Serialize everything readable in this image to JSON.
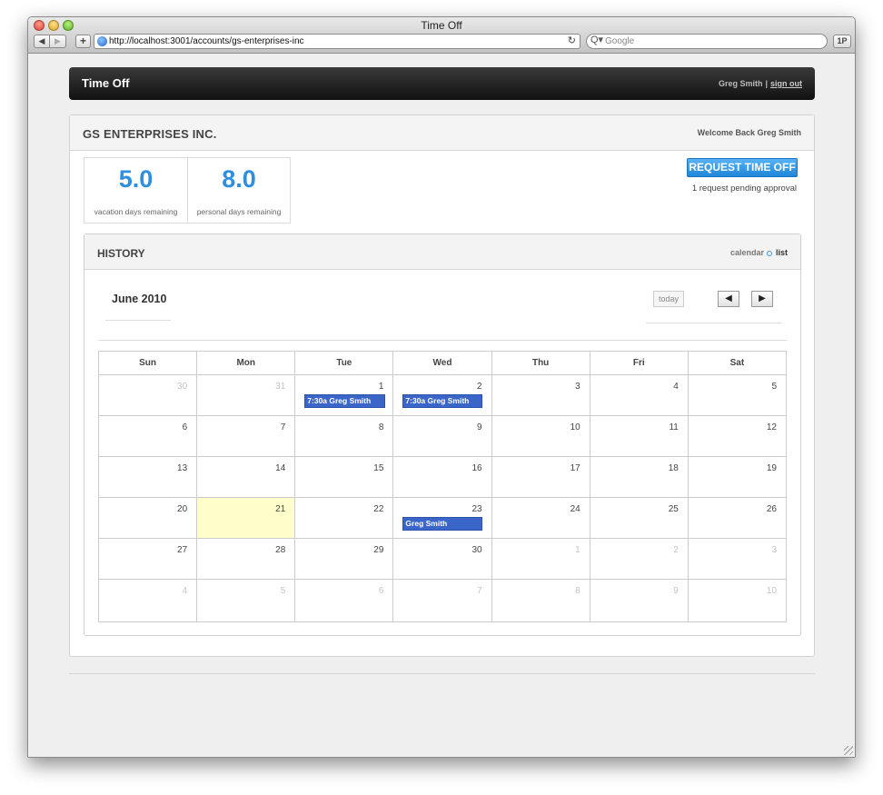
{
  "browser": {
    "title": "Time Off",
    "back_icon": "◀",
    "forward_icon": "▶",
    "add_icon": "+",
    "url": "http://localhost:3001/accounts/gs-enterprises-inc",
    "reload_icon": "↻",
    "search_placeholder": "Google",
    "search_icon": "Q▾",
    "extension_label": "1P"
  },
  "header": {
    "brand": "Time Off",
    "user_name": "Greg Smith",
    "separator": "|",
    "sign_out": "sign out"
  },
  "account": {
    "company": "GS ENTERPRISES INC.",
    "welcome": "Welcome Back Greg Smith"
  },
  "stats": [
    {
      "value": "5.0",
      "label": "vacation days remaining"
    },
    {
      "value": "8.0",
      "label": "personal days remaining"
    }
  ],
  "request": {
    "button_label": "REQUEST TIME OFF",
    "pending_text": "1 request pending approval"
  },
  "history": {
    "title": "HISTORY",
    "view_calendar": "calendar",
    "view_list": "list",
    "month": "June 2010",
    "today_label": "today",
    "prev_icon": "◀",
    "next_icon": "▶",
    "day_headers": [
      "Sun",
      "Mon",
      "Tue",
      "Wed",
      "Thu",
      "Fri",
      "Sat"
    ],
    "weeks": [
      [
        {
          "day": "30",
          "other": true
        },
        {
          "day": "31",
          "other": true
        },
        {
          "day": "1",
          "event": "7:30a Greg Smith"
        },
        {
          "day": "2",
          "event": "7:30a Greg Smith"
        },
        {
          "day": "3"
        },
        {
          "day": "4"
        },
        {
          "day": "5"
        }
      ],
      [
        {
          "day": "6"
        },
        {
          "day": "7"
        },
        {
          "day": "8"
        },
        {
          "day": "9"
        },
        {
          "day": "10"
        },
        {
          "day": "11"
        },
        {
          "day": "12"
        }
      ],
      [
        {
          "day": "13"
        },
        {
          "day": "14"
        },
        {
          "day": "15"
        },
        {
          "day": "16"
        },
        {
          "day": "17"
        },
        {
          "day": "18"
        },
        {
          "day": "19"
        }
      ],
      [
        {
          "day": "20"
        },
        {
          "day": "21",
          "today": true
        },
        {
          "day": "22"
        },
        {
          "day": "23",
          "event": "Greg Smith"
        },
        {
          "day": "24"
        },
        {
          "day": "25"
        },
        {
          "day": "26"
        }
      ],
      [
        {
          "day": "27"
        },
        {
          "day": "28"
        },
        {
          "day": "29"
        },
        {
          "day": "30"
        },
        {
          "day": "1",
          "other": true
        },
        {
          "day": "2",
          "other": true
        },
        {
          "day": "3",
          "other": true
        }
      ],
      [
        {
          "day": "4",
          "other": true
        },
        {
          "day": "5",
          "other": true
        },
        {
          "day": "6",
          "other": true
        },
        {
          "day": "7",
          "other": true
        },
        {
          "day": "8",
          "other": true
        },
        {
          "day": "9",
          "other": true
        },
        {
          "day": "10",
          "other": true
        }
      ]
    ]
  },
  "colors": {
    "accent": "#2d8fe0",
    "event": "#3a65c9",
    "today_highlight": "#ffffcc",
    "header_bg": "#1a1a1a"
  }
}
